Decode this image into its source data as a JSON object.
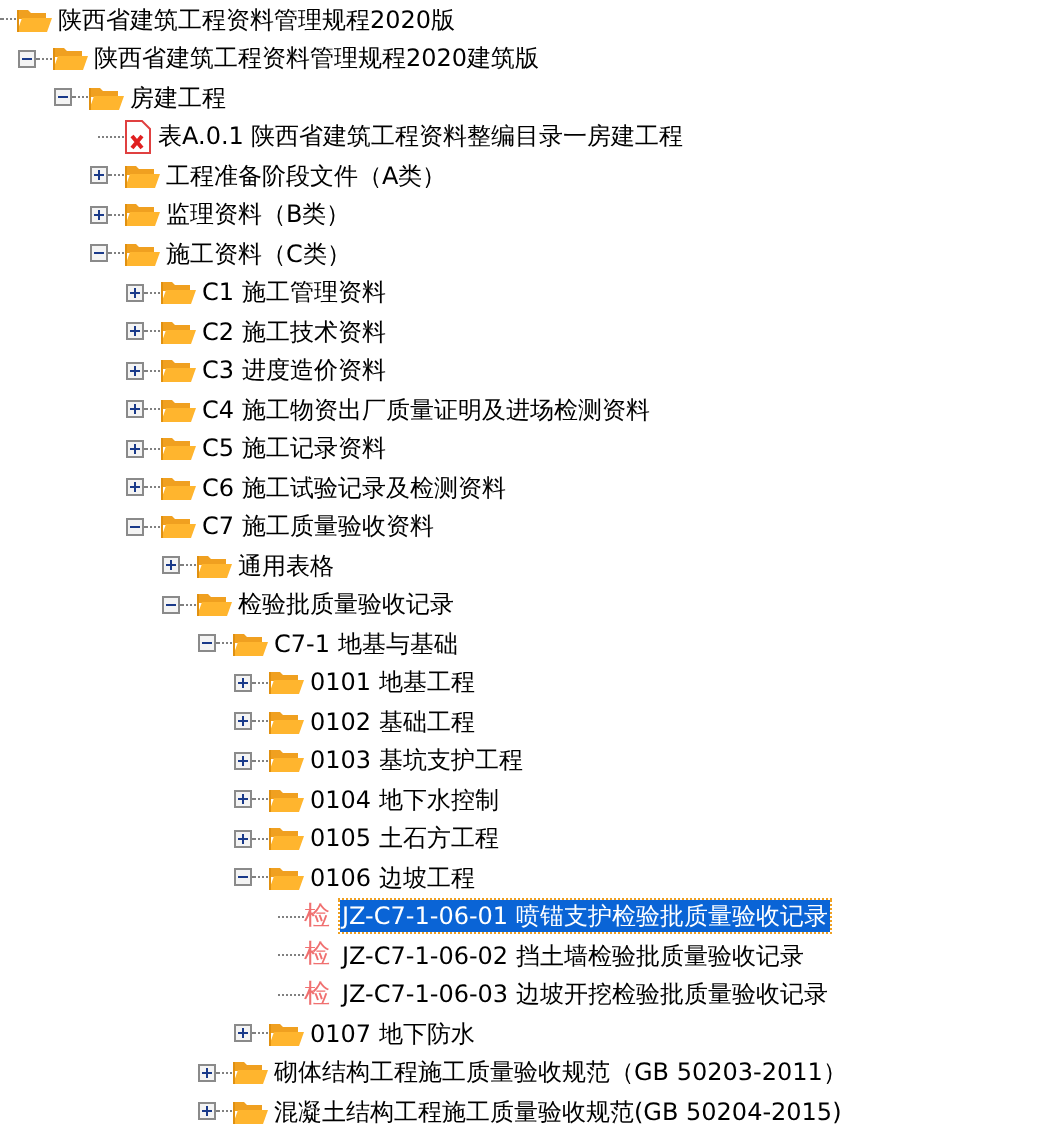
{
  "tree": [
    {
      "label": "陕西省建筑工程资料管理规程2020版",
      "kind": "folder",
      "children": [
        {
          "label": "陕西省建筑工程资料管理规程2020建筑版",
          "kind": "folder",
          "expanded": true,
          "children": [
            {
              "label": "房建工程",
              "kind": "folder",
              "expanded": true,
              "children": [
                {
                  "label": "表A.0.1 陕西省建筑工程资料整编目录一房建工程",
                  "kind": "pdf"
                },
                {
                  "label": "工程准备阶段文件（A类）",
                  "kind": "folder",
                  "expanded": false
                },
                {
                  "label": "监理资料（B类）",
                  "kind": "folder",
                  "expanded": false
                },
                {
                  "label": "施工资料（C类）",
                  "kind": "folder",
                  "expanded": true,
                  "children": [
                    {
                      "label": "C1 施工管理资料",
                      "kind": "folder",
                      "expanded": false
                    },
                    {
                      "label": "C2 施工技术资料",
                      "kind": "folder",
                      "expanded": false
                    },
                    {
                      "label": "C3 进度造价资料",
                      "kind": "folder",
                      "expanded": false
                    },
                    {
                      "label": "C4 施工物资出厂质量证明及进场检测资料",
                      "kind": "folder",
                      "expanded": false
                    },
                    {
                      "label": "C5 施工记录资料",
                      "kind": "folder",
                      "expanded": false
                    },
                    {
                      "label": "C6 施工试验记录及检测资料",
                      "kind": "folder",
                      "expanded": false
                    },
                    {
                      "label": "C7 施工质量验收资料",
                      "kind": "folder",
                      "expanded": true,
                      "children": [
                        {
                          "label": "通用表格",
                          "kind": "folder",
                          "expanded": false
                        },
                        {
                          "label": "检验批质量验收记录",
                          "kind": "folder",
                          "expanded": true,
                          "children": [
                            {
                              "label": "C7-1 地基与基础",
                              "kind": "folder",
                              "expanded": true,
                              "children": [
                                {
                                  "label": "0101 地基工程",
                                  "kind": "folder",
                                  "expanded": false
                                },
                                {
                                  "label": "0102 基础工程",
                                  "kind": "folder",
                                  "expanded": false
                                },
                                {
                                  "label": "0103 基坑支护工程",
                                  "kind": "folder",
                                  "expanded": false
                                },
                                {
                                  "label": "0104 地下水控制",
                                  "kind": "folder",
                                  "expanded": false
                                },
                                {
                                  "label": "0105 土石方工程",
                                  "kind": "folder",
                                  "expanded": false
                                },
                                {
                                  "label": "0106 边坡工程",
                                  "kind": "folder",
                                  "expanded": true,
                                  "children": [
                                    {
                                      "label": "JZ-C7-1-06-01 喷锚支护检验批质量验收记录",
                                      "kind": "form",
                                      "badge": "检",
                                      "selected": true
                                    },
                                    {
                                      "label": "JZ-C7-1-06-02 挡土墙检验批质量验收记录",
                                      "kind": "form",
                                      "badge": "检",
                                      "selected": false
                                    },
                                    {
                                      "label": "JZ-C7-1-06-03 边坡开挖检验批质量验收记录",
                                      "kind": "form",
                                      "badge": "检",
                                      "selected": false
                                    }
                                  ]
                                },
                                {
                                  "label": "0107 地下防水",
                                  "kind": "folder",
                                  "expanded": false
                                }
                              ]
                            },
                            {
                              "label": "砌体结构工程施工质量验收规范（GB 50203-2011）",
                              "kind": "folder",
                              "expanded": false
                            },
                            {
                              "label": "混凝土结构工程施工质量验收规范(GB 50204-2015)",
                              "kind": "folder",
                              "expanded": false
                            }
                          ]
                        }
                      ]
                    }
                  ]
                }
              ]
            }
          ]
        }
      ]
    }
  ]
}
